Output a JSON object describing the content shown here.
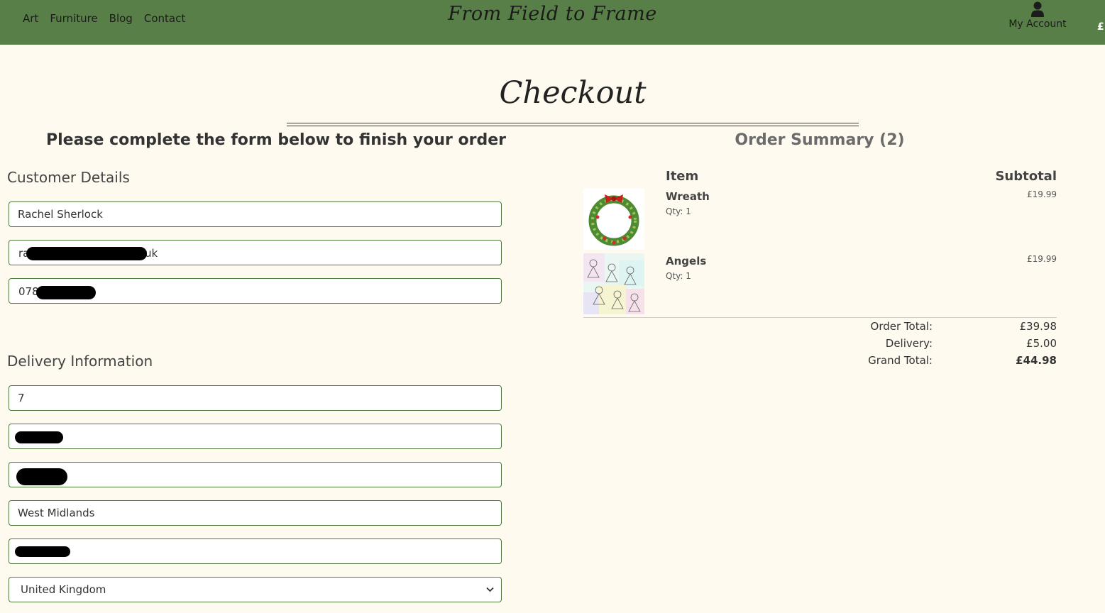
{
  "header": {
    "nav": [
      "Art",
      "Furniture",
      "Blog",
      "Contact"
    ],
    "brand": "From Field to Frame",
    "account_label": "My Account",
    "cart_label": "£"
  },
  "page": {
    "title": "Checkout",
    "form_heading": "Please complete the form below to finish your order",
    "summary_heading": "Order Summary (2)"
  },
  "customer": {
    "label": "Customer Details",
    "full_name": "Rachel Sherlock",
    "email_visible_start": "ra",
    "email_visible_end": "uk",
    "phone_visible_start": "078"
  },
  "delivery": {
    "label": "Delivery Information",
    "street_address1": "7",
    "street_address2": "",
    "town": "",
    "county": "West Midlands",
    "postcode": "",
    "country": "United Kingdom"
  },
  "summary": {
    "item_header": "Item",
    "subtotal_header": "Subtotal",
    "items": [
      {
        "name": "Wreath",
        "qty": "Qty: 1",
        "price": "£19.99",
        "image": "wreath-image"
      },
      {
        "name": "Angels",
        "qty": "Qty: 1",
        "price": "£19.99",
        "image": "angels-image"
      }
    ],
    "order_total_label": "Order Total:",
    "order_total": "£39.98",
    "delivery_label": "Delivery:",
    "delivery": "£5.00",
    "grand_total_label": "Grand Total:",
    "grand_total": "£44.98"
  },
  "colors": {
    "header_bg": "#587f47",
    "page_bg": "#fefaf0",
    "field_border": "#4f7a3d"
  }
}
